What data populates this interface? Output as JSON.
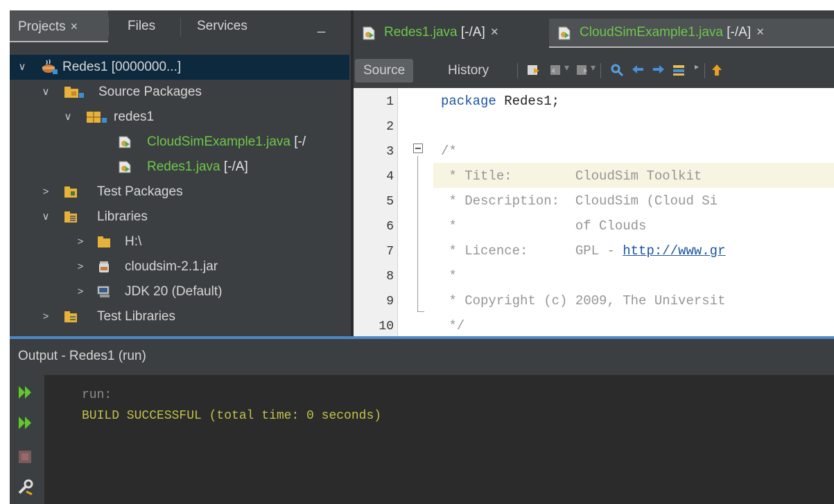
{
  "projects_panel": {
    "tabs": [
      {
        "label": "Projects",
        "close": "×"
      },
      {
        "label": "Files"
      },
      {
        "label": "Services"
      }
    ],
    "minimize": "_",
    "tree": [
      {
        "label": "Redes1 [0000000...]",
        "icon": "coffee-project-icon"
      },
      {
        "label": "Source Packages",
        "icon": "source-packages-icon"
      },
      {
        "label": "redes1",
        "icon": "package-icon"
      },
      {
        "label": "CloudSimExample1.java",
        "tag": "[-/",
        "icon": "java-file-icon"
      },
      {
        "label": "Redes1.java",
        "tag": "[-/A]",
        "icon": "java-file-icon"
      },
      {
        "label": "Test Packages",
        "icon": "test-packages-icon"
      },
      {
        "label": "Libraries",
        "icon": "libraries-icon"
      },
      {
        "label": "H:\\",
        "icon": "folder-icon"
      },
      {
        "label": "cloudsim-2.1.jar",
        "icon": "jar-icon"
      },
      {
        "label": "JDK 20 (Default)",
        "icon": "jdk-icon"
      },
      {
        "label": "Test Libraries",
        "icon": "test-libraries-icon"
      }
    ]
  },
  "editor": {
    "tabs": [
      {
        "file": "Redes1.java",
        "tag": "[-/A]",
        "close": "×"
      },
      {
        "file": "CloudSimExample1.java",
        "tag": "[-/A]",
        "close": "×"
      }
    ],
    "toolbar": {
      "source": "Source",
      "history": "History"
    },
    "line_numbers": [
      "1",
      "2",
      "3",
      "4",
      "5",
      "6",
      "7",
      "8",
      "9",
      "10"
    ],
    "code": {
      "l1_kw": "package",
      "l1_rest": " Redes1;",
      "l3": "/*",
      "l4": " * Title:        CloudSim Toolkit",
      "l5": " * Description:  CloudSim (Cloud Si",
      "l6": " *               of Clouds",
      "l7_pre": " * Licence:      GPL - ",
      "l7_link": "http://www.gr",
      "l8": " *",
      "l9": " * Copyright (c) 2009, The Universit",
      "l10": " */"
    }
  },
  "output": {
    "title": "Output - Redes1 (run)",
    "lines": [
      "run:",
      "BUILD SUCCESSFUL (total time: 0 seconds)"
    ]
  },
  "colors": {
    "green_file": "#6ec74a",
    "output_text": "#c2c24a",
    "output_dim": "#8c8c8c",
    "accent": "#4a88c7"
  }
}
